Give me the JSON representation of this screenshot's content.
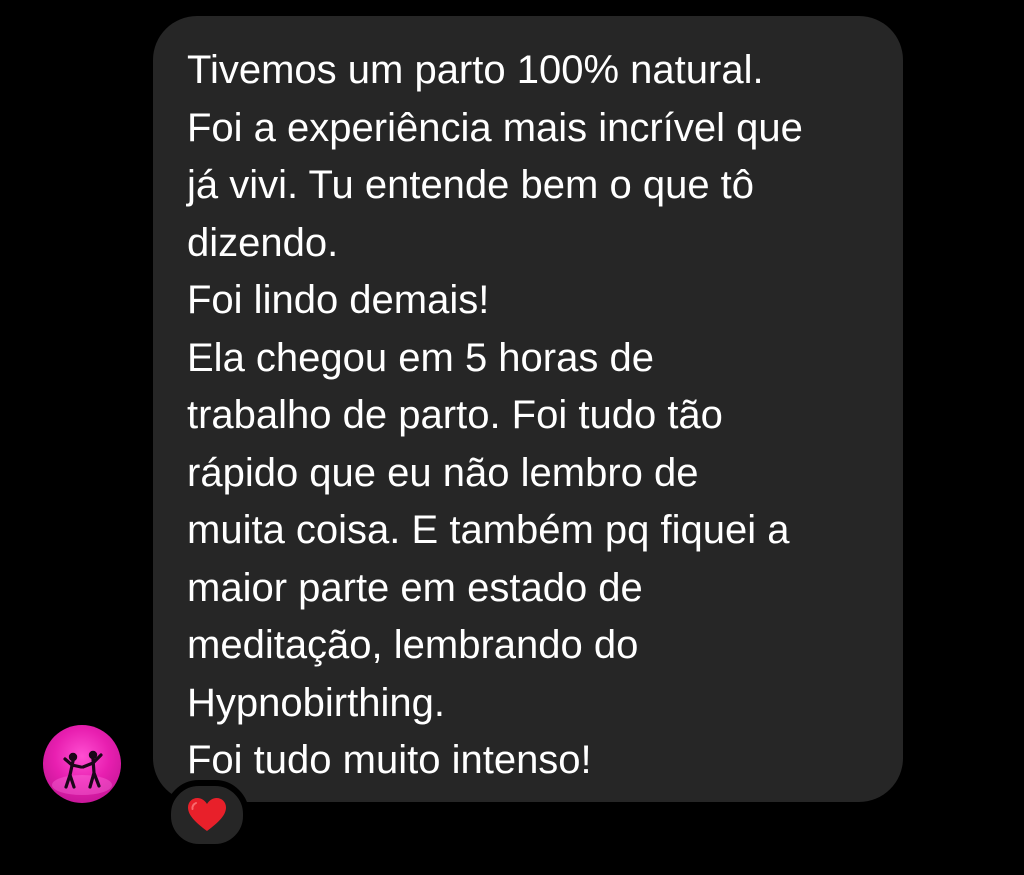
{
  "message": {
    "lines": [
      "Tivemos um parto 100% natural.",
      "Foi a experiência mais incrível que",
      "já vivi. Tu entende bem o que tô",
      "dizendo.",
      "Foi lindo demais!",
      "Ela chegou em 5 horas de",
      "trabalho de parto. Foi tudo tão",
      "rápido que eu não lembro de",
      "muita coisa. E também pq fiquei a",
      "maior parte em estado de",
      "meditação, lembrando do",
      "Hypnobirthing.",
      "Foi tudo muito intenso!"
    ]
  },
  "reaction": {
    "icon": "red-heart-icon",
    "color": "#e8202a"
  },
  "avatar": {
    "icon": "dancing-couple-icon",
    "color": "#e81fb0"
  },
  "colors": {
    "background": "#000000",
    "bubble": "#262626",
    "text": "#ffffff"
  }
}
